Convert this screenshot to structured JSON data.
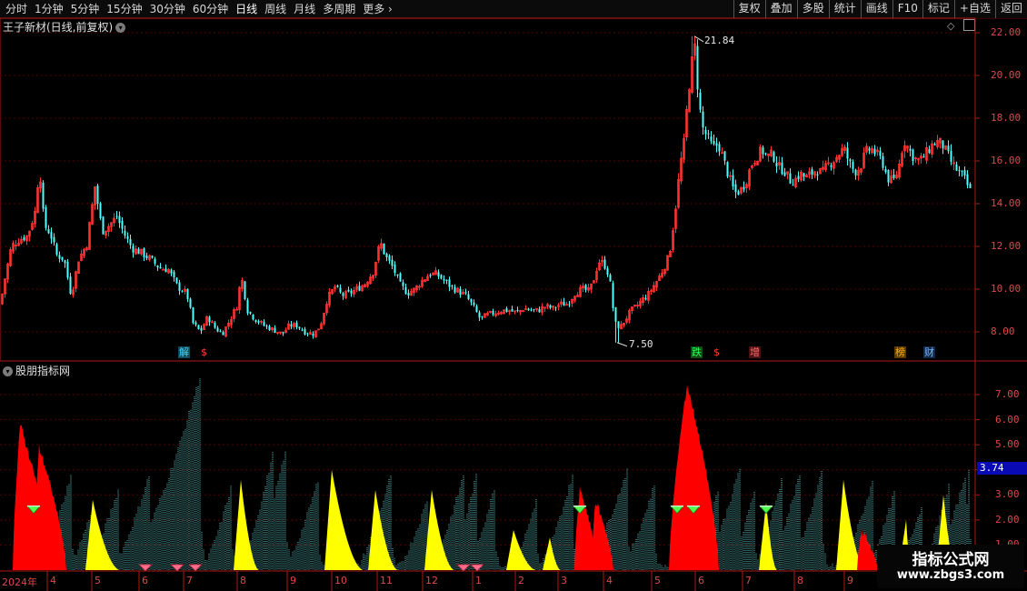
{
  "toolbar": {
    "periods": [
      "分时",
      "1分钟",
      "5分钟",
      "15分钟",
      "30分钟",
      "60分钟",
      "日线",
      "周线",
      "月线",
      "多周期",
      "更多"
    ],
    "active_period": "日线",
    "more_arrow": "›",
    "right_buttons": [
      "复权",
      "叠加",
      "多股",
      "统计",
      "画线",
      "F10",
      "标记",
      "+自选",
      "返回"
    ]
  },
  "main_pane": {
    "title": "王子新材(日线,前复权)",
    "y_ticks": [
      "22.00",
      "20.00",
      "18.00",
      "16.00",
      "14.00",
      "12.00",
      "10.00",
      "8.00"
    ],
    "high_label": "21.84",
    "low_label": "7.50",
    "tags": [
      {
        "text": "解",
        "color": "#3fd0ff",
        "bg": "#134a5a"
      },
      {
        "text": "$",
        "color": "#ff3a3a",
        "bg": ""
      },
      {
        "text": "跌",
        "color": "#33ff55",
        "bg": "#134a13"
      },
      {
        "text": "$",
        "color": "#ff3a3a",
        "bg": ""
      },
      {
        "text": "增",
        "color": "#ff6b6b",
        "bg": "#4a1313"
      },
      {
        "text": "榜",
        "color": "#ffb000",
        "bg": "#5a3a00"
      },
      {
        "text": "财",
        "color": "#7ab8ff",
        "bg": "#13294a"
      }
    ]
  },
  "sub_pane": {
    "title": "股朋指标网",
    "y_ticks": [
      "7.00",
      "6.00",
      "5.00",
      "4.00",
      "3.00",
      "2.00",
      "1.00"
    ],
    "current_value": "3.74"
  },
  "x_axis": {
    "labels": [
      "2024年",
      "4",
      "5",
      "6",
      "7",
      "8",
      "9",
      "10",
      "11",
      "12",
      "1",
      "2",
      "3",
      "4",
      "5",
      "6",
      "7",
      "8",
      "9"
    ]
  },
  "watermark": {
    "line1": "指标公式网",
    "line2": "www.zbgs3.com"
  },
  "colors": {
    "up": "#ff3232",
    "down": "#54ffff",
    "axis": "#b01818",
    "grid": "#5a0000",
    "ind_red": "#ff0000",
    "ind_yellow": "#ffff00",
    "ind_teal": "#5fc8c8"
  },
  "chart_data": [
    {
      "type": "candlestick",
      "title": "王子新材(日线,前复权)",
      "ylim": [
        7.0,
        22.5
      ],
      "x_labels": [
        "2024年",
        "4",
        "5",
        "6",
        "7",
        "8",
        "9",
        "10",
        "11",
        "12",
        "1",
        "2",
        "3",
        "4",
        "5",
        "6",
        "7",
        "8",
        "9"
      ],
      "close_path": [
        [
          0,
          9.3
        ],
        [
          5,
          10.5
        ],
        [
          12,
          12.0
        ],
        [
          20,
          12.3
        ],
        [
          30,
          12.5
        ],
        [
          38,
          13.6
        ],
        [
          43,
          15.8
        ],
        [
          48,
          13.0
        ],
        [
          55,
          12.6
        ],
        [
          62,
          11.6
        ],
        [
          70,
          11.4
        ],
        [
          78,
          9.7
        ],
        [
          86,
          11.4
        ],
        [
          95,
          12.1
        ],
        [
          104,
          14.8
        ],
        [
          112,
          12.7
        ],
        [
          120,
          13.0
        ],
        [
          128,
          13.4
        ],
        [
          136,
          12.6
        ],
        [
          145,
          11.9
        ],
        [
          155,
          11.7
        ],
        [
          165,
          11.4
        ],
        [
          175,
          11.0
        ],
        [
          185,
          10.9
        ],
        [
          195,
          10.1
        ],
        [
          205,
          9.8
        ],
        [
          212,
          8.4
        ],
        [
          220,
          8.0
        ],
        [
          228,
          8.7
        ],
        [
          236,
          8.2
        ],
        [
          244,
          7.9
        ],
        [
          252,
          8.5
        ],
        [
          260,
          9.2
        ],
        [
          265,
          10.6
        ],
        [
          272,
          9.0
        ],
        [
          280,
          8.6
        ],
        [
          290,
          8.3
        ],
        [
          300,
          8.1
        ],
        [
          310,
          7.9
        ],
        [
          318,
          8.3
        ],
        [
          326,
          8.3
        ],
        [
          335,
          8.0
        ],
        [
          345,
          7.9
        ],
        [
          352,
          8.3
        ],
        [
          360,
          9.6
        ],
        [
          368,
          10.1
        ],
        [
          376,
          9.7
        ],
        [
          384,
          9.8
        ],
        [
          392,
          10.0
        ],
        [
          400,
          10.2
        ],
        [
          410,
          10.8
        ],
        [
          418,
          12.2
        ],
        [
          424,
          11.5
        ],
        [
          432,
          11.0
        ],
        [
          440,
          10.2
        ],
        [
          448,
          9.8
        ],
        [
          456,
          10.0
        ],
        [
          464,
          10.4
        ],
        [
          472,
          10.7
        ],
        [
          480,
          10.7
        ],
        [
          488,
          10.4
        ],
        [
          496,
          10.1
        ],
        [
          504,
          9.9
        ],
        [
          512,
          9.7
        ],
        [
          520,
          9.2
        ],
        [
          528,
          8.6
        ],
        [
          536,
          8.8
        ],
        [
          544,
          8.9
        ],
        [
          552,
          9.0
        ],
        [
          560,
          9.0
        ],
        [
          568,
          8.9
        ],
        [
          576,
          9.1
        ],
        [
          584,
          9.0
        ],
        [
          592,
          9.0
        ],
        [
          600,
          9.2
        ],
        [
          608,
          9.1
        ],
        [
          616,
          9.3
        ],
        [
          624,
          9.3
        ],
        [
          632,
          9.8
        ],
        [
          640,
          10.0
        ],
        [
          648,
          9.9
        ],
        [
          654,
          10.6
        ],
        [
          658,
          11.3
        ],
        [
          664,
          11.2
        ],
        [
          670,
          10.6
        ],
        [
          676,
          8.4
        ],
        [
          682,
          8.2
        ],
        [
          688,
          8.6
        ],
        [
          694,
          9.0
        ],
        [
          700,
          9.2
        ],
        [
          706,
          9.5
        ],
        [
          712,
          9.7
        ],
        [
          718,
          10.1
        ],
        [
          724,
          10.5
        ],
        [
          730,
          11.0
        ],
        [
          736,
          11.6
        ],
        [
          742,
          13.5
        ],
        [
          748,
          15.8
        ],
        [
          752,
          16.8
        ],
        [
          756,
          18.8
        ],
        [
          760,
          20.4
        ],
        [
          764,
          21.3
        ],
        [
          768,
          19.0
        ],
        [
          772,
          17.6
        ],
        [
          778,
          17.1
        ],
        [
          784,
          16.6
        ],
        [
          790,
          16.8
        ],
        [
          796,
          16.0
        ],
        [
          802,
          15.2
        ],
        [
          808,
          14.5
        ],
        [
          814,
          14.6
        ],
        [
          820,
          15.0
        ],
        [
          826,
          15.8
        ],
        [
          832,
          16.2
        ],
        [
          838,
          16.5
        ],
        [
          844,
          16.2
        ],
        [
          850,
          16.3
        ],
        [
          856,
          15.7
        ],
        [
          862,
          15.6
        ],
        [
          868,
          15.1
        ],
        [
          874,
          15.1
        ],
        [
          880,
          15.4
        ],
        [
          886,
          15.2
        ],
        [
          892,
          15.4
        ],
        [
          898,
          15.6
        ],
        [
          904,
          15.4
        ],
        [
          910,
          15.8
        ],
        [
          916,
          16.0
        ],
        [
          922,
          16.3
        ],
        [
          928,
          16.6
        ],
        [
          934,
          15.9
        ],
        [
          940,
          15.5
        ],
        [
          946,
          15.7
        ],
        [
          952,
          16.4
        ],
        [
          958,
          16.6
        ],
        [
          964,
          16.3
        ],
        [
          970,
          16.0
        ],
        [
          976,
          15.2
        ],
        [
          982,
          15.0
        ],
        [
          988,
          15.6
        ],
        [
          994,
          17.0
        ],
        [
          1000,
          16.5
        ],
        [
          1006,
          16.1
        ],
        [
          1012,
          16.0
        ],
        [
          1018,
          16.3
        ],
        [
          1024,
          16.7
        ],
        [
          1030,
          16.9
        ],
        [
          1036,
          16.8
        ],
        [
          1042,
          16.3
        ],
        [
          1048,
          15.8
        ],
        [
          1054,
          15.5
        ],
        [
          1060,
          15.2
        ],
        [
          1067,
          14.6
        ]
      ],
      "annotations": {
        "max": 21.84,
        "min": 7.5
      }
    },
    {
      "type": "bar",
      "title": "股朋指标网",
      "ylim": [
        0,
        8.0
      ],
      "current_value": 3.74,
      "teal_bursts": [
        {
          "peak": 1060,
          "amp": 1.4,
          "left": 28
        },
        {
          "peak": 72,
          "amp": 2.1,
          "left": 36
        },
        {
          "peak": 78,
          "amp": 3.8,
          "left": 40
        },
        {
          "peak": 102,
          "amp": 2.5,
          "left": 30
        },
        {
          "peak": 130,
          "amp": 3.2,
          "left": 40
        },
        {
          "peak": 165,
          "amp": 3.9,
          "left": 45
        },
        {
          "peak": 220,
          "amp": 7.7,
          "left": 85
        },
        {
          "peak": 255,
          "amp": 3.4,
          "left": 35
        },
        {
          "peak": 300,
          "amp": 4.6,
          "left": 40
        },
        {
          "peak": 315,
          "amp": 4.8,
          "left": 45
        },
        {
          "peak": 350,
          "amp": 3.6,
          "left": 40
        },
        {
          "peak": 430,
          "amp": 3.8,
          "left": 40
        },
        {
          "peak": 470,
          "amp": 2.8,
          "left": 35
        },
        {
          "peak": 510,
          "amp": 3.8,
          "left": 40
        },
        {
          "peak": 525,
          "amp": 3.9,
          "left": 35
        },
        {
          "peak": 545,
          "amp": 3.4,
          "left": 35
        },
        {
          "peak": 590,
          "amp": 2.8,
          "left": 30
        },
        {
          "peak": 630,
          "amp": 3.8,
          "left": 40
        },
        {
          "peak": 690,
          "amp": 4.0,
          "left": 50
        },
        {
          "peak": 720,
          "amp": 3.4,
          "left": 40
        },
        {
          "peak": 790,
          "amp": 3.2,
          "left": 35
        },
        {
          "peak": 815,
          "amp": 4.2,
          "left": 45
        },
        {
          "peak": 830,
          "amp": 3.2,
          "left": 30
        },
        {
          "peak": 860,
          "amp": 3.6,
          "left": 35
        },
        {
          "peak": 880,
          "amp": 3.8,
          "left": 40
        },
        {
          "peak": 905,
          "amp": 4.0,
          "left": 40
        },
        {
          "peak": 960,
          "amp": 3.5,
          "left": 40
        },
        {
          "peak": 985,
          "amp": 3.2,
          "left": 35
        },
        {
          "peak": 1015,
          "amp": 2.6,
          "left": 35
        },
        {
          "peak": 1045,
          "amp": 3.5,
          "left": 35
        },
        {
          "peak": 1063,
          "amp": 3.9,
          "left": 40
        },
        {
          "peak": 1067,
          "amp": 4.5,
          "left": 10
        }
      ],
      "red_bursts": [
        {
          "peak": 22,
          "amp": 5.8,
          "left": 8,
          "right": 35
        },
        {
          "peak": 43,
          "amp": 4.9,
          "left": 6,
          "right": 30
        },
        {
          "peak": 638,
          "amp": 3.2,
          "left": 6,
          "right": 20
        },
        {
          "peak": 655,
          "amp": 2.8,
          "left": 4,
          "right": 20
        },
        {
          "peak": 756,
          "amp": 7.4,
          "left": 20,
          "right": 35
        },
        {
          "peak": 948,
          "amp": 1.6,
          "left": 5,
          "right": 18
        }
      ],
      "yellow_bursts": [
        {
          "peak": 102,
          "amp": 2.8,
          "right": 30
        },
        {
          "peak": 265,
          "amp": 3.6,
          "right": 20
        },
        {
          "peak": 365,
          "amp": 4.0,
          "right": 35
        },
        {
          "peak": 413,
          "amp": 3.2,
          "right": 25
        },
        {
          "peak": 475,
          "amp": 3.2,
          "right": 25
        },
        {
          "peak": 565,
          "amp": 1.6,
          "right": 25
        },
        {
          "peak": 605,
          "amp": 1.3,
          "right": 12
        },
        {
          "peak": 745,
          "amp": 3.2,
          "right": 0
        },
        {
          "peak": 843,
          "amp": 2.7,
          "right": 12
        },
        {
          "peak": 928,
          "amp": 3.6,
          "right": 25
        },
        {
          "peak": 997,
          "amp": 2.0,
          "right": 6
        },
        {
          "peak": 1038,
          "amp": 3.0,
          "right": 15
        }
      ],
      "green_gems": [
        37,
        638,
        745,
        763,
        843
      ],
      "pink_gems": [
        160,
        195,
        215,
        510,
        525
      ]
    }
  ]
}
